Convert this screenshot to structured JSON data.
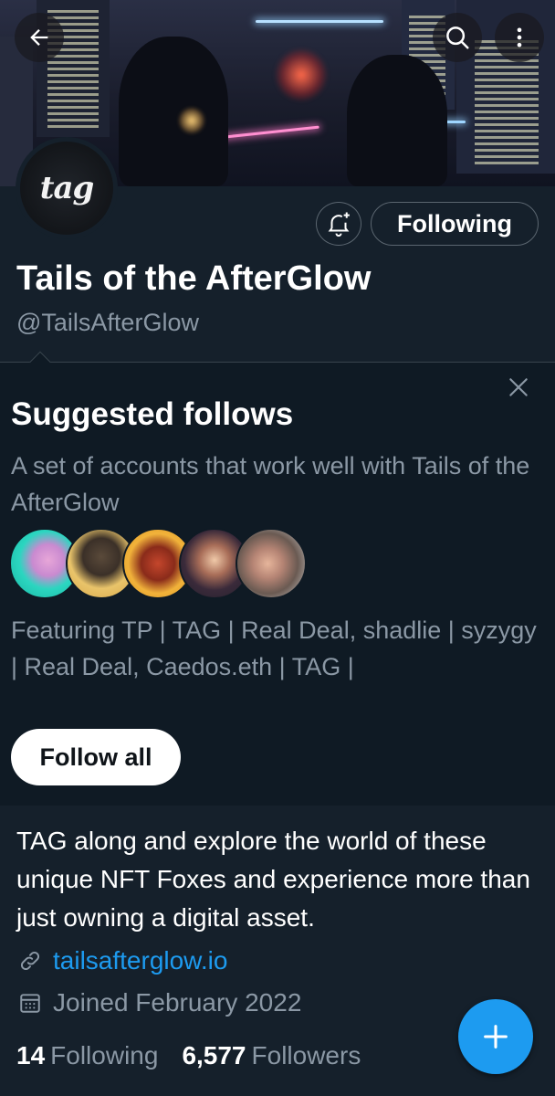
{
  "profile": {
    "display_name": "Tails of the AfterGlow",
    "handle": "@TailsAfterGlow",
    "avatar_text": "tag",
    "following_button": "Following",
    "bio": "TAG along and explore the world of these unique NFT Foxes and experience more than just owning a digital asset.",
    "website": "tailsafterglow.io",
    "joined": "Joined February 2022",
    "following_count": "14",
    "following_label": "Following",
    "followers_count": "6,577",
    "followers_label": "Followers"
  },
  "suggested": {
    "title": "Suggested follows",
    "subtitle": "A set of accounts that work well with Tails of the AfterGlow",
    "featuring": "Featuring TP | TAG | Real Deal, shadlie | syzygy | Real Deal, Caedos.eth | TAG |",
    "follow_all": "Follow all",
    "avatars": [
      "teal-fox-avatar",
      "wolf-hat-avatar",
      "red-fox-avatar",
      "anime-avatar",
      "photo-avatar"
    ]
  },
  "icons": {
    "back": "back-arrow-icon",
    "search": "search-icon",
    "more": "more-vertical-icon",
    "notify": "bell-plus-icon",
    "close": "close-icon",
    "link": "link-icon",
    "calendar": "calendar-icon",
    "compose": "plus-icon"
  },
  "colors": {
    "background": "#15202b",
    "card": "#0f1a24",
    "accent": "#1d9bf0",
    "secondary_text": "#8b98a5"
  }
}
